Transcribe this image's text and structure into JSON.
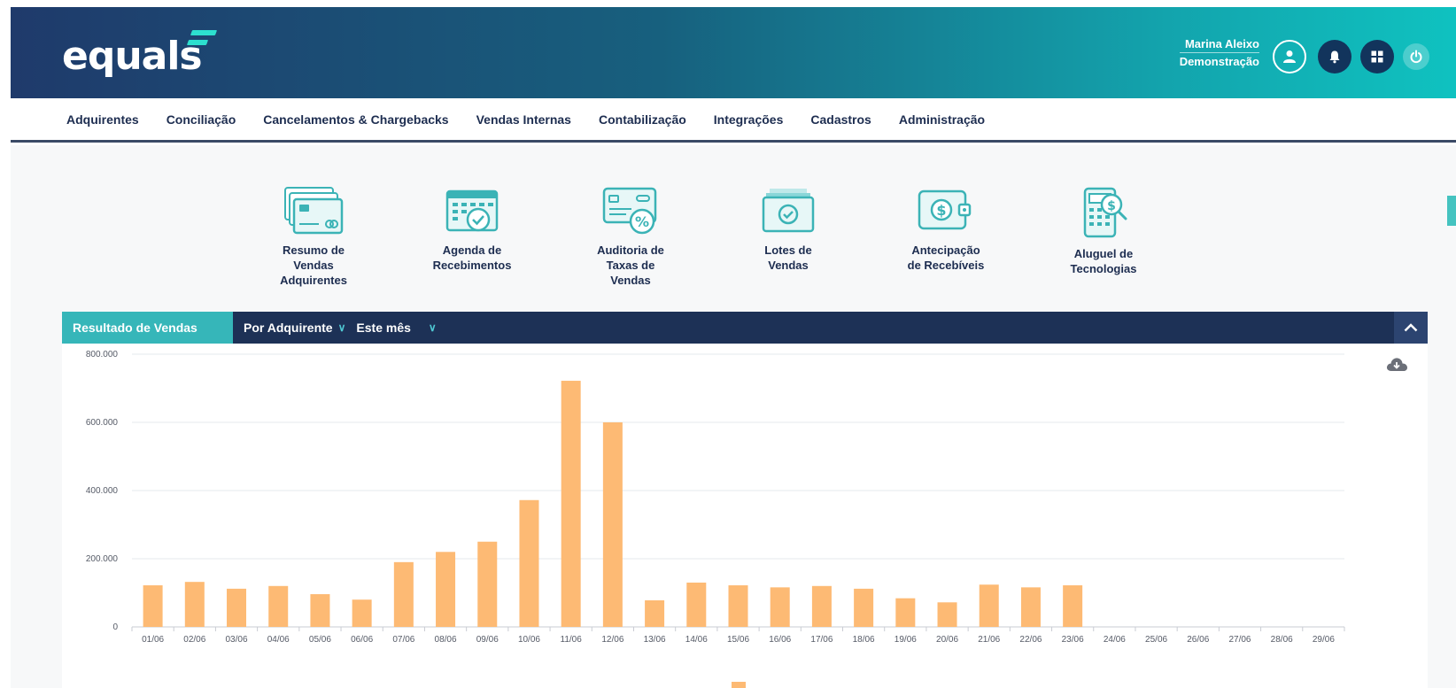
{
  "header": {
    "logo_text": "equals",
    "user_name": "Marina Aleixo",
    "user_role": "Demonstração"
  },
  "nav": {
    "items": [
      "Adquirentes",
      "Conciliação",
      "Cancelamentos & Chargebacks",
      "Vendas Internas",
      "Contabilização",
      "Integrações",
      "Cadastros",
      "Administração"
    ]
  },
  "shortcuts": [
    {
      "label": "Resumo de\nVendas\nAdquirentes",
      "icon": "credit-cards-icon"
    },
    {
      "label": "Agenda de\nRecebimentos",
      "icon": "calendar-check-icon"
    },
    {
      "label": "Auditoria de\nTaxas de\nVendas",
      "icon": "card-percent-icon"
    },
    {
      "label": "Lotes de\nVendas",
      "icon": "stack-check-icon"
    },
    {
      "label": "Antecipação\nde Recebíveis",
      "icon": "wallet-dollar-icon"
    },
    {
      "label": "Aluguel de\nTecnologias",
      "icon": "pos-terminal-icon"
    }
  ],
  "panel": {
    "title": "Resultado de Vendas",
    "filter_group": "Por Adquirente",
    "filter_period": "Este mês"
  },
  "colors": {
    "accent": "#36b6b9",
    "navy": "#1d3156",
    "bar": "#fdba74"
  },
  "chart_data": {
    "type": "bar",
    "categories": [
      "01/06",
      "02/06",
      "03/06",
      "04/06",
      "05/06",
      "06/06",
      "07/06",
      "08/06",
      "09/06",
      "10/06",
      "11/06",
      "12/06",
      "13/06",
      "14/06",
      "15/06",
      "16/06",
      "17/06",
      "18/06",
      "19/06",
      "20/06",
      "21/06",
      "22/06",
      "23/06",
      "24/06",
      "25/06",
      "26/06",
      "27/06",
      "28/06",
      "29/06"
    ],
    "values": [
      122000,
      132000,
      112000,
      120000,
      96000,
      80000,
      190000,
      220000,
      250000,
      372000,
      722000,
      600000,
      78000,
      130000,
      122000,
      116000,
      120000,
      112000,
      84000,
      72000,
      124000,
      116000,
      122000,
      0,
      0,
      0,
      0,
      0,
      0
    ],
    "ylim": [
      0,
      800000
    ],
    "yticks": [
      "0",
      "200.000",
      "400.000",
      "600.000",
      "800.000"
    ],
    "grid": true
  }
}
